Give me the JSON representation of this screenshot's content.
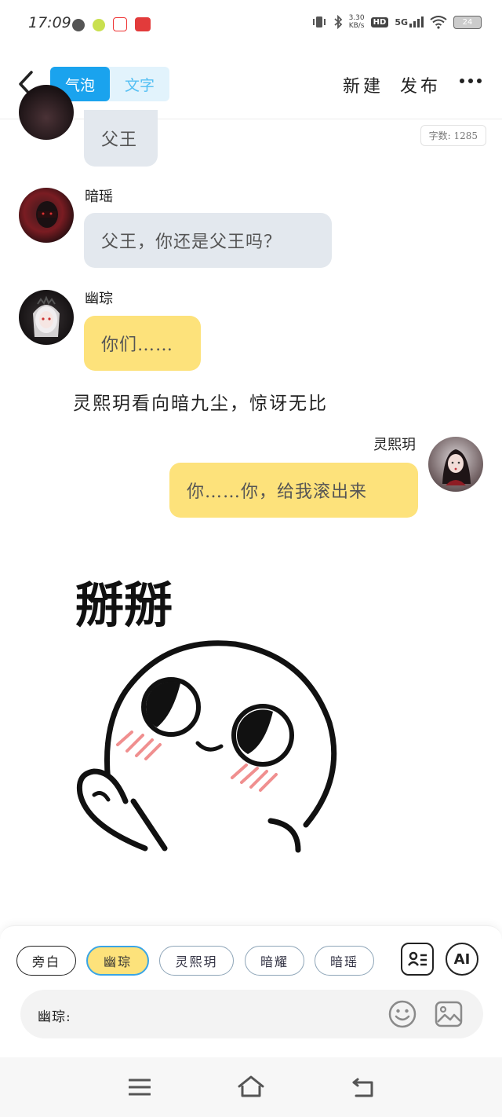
{
  "status_bar": {
    "time": "17:09",
    "net_speed_value": "3.30",
    "net_speed_unit": "KB/s",
    "hd": "HD",
    "network": "5G",
    "battery": "24"
  },
  "top_bar": {
    "tab_bubble": "气泡",
    "tab_text": "文字",
    "new_label": "新建",
    "publish_label": "发布"
  },
  "word_count": "字数: 1285",
  "messages": [
    {
      "text": "父王"
    },
    {
      "name": "暗瑶",
      "text": "父王，你还是父王吗？"
    },
    {
      "name": "幽琮",
      "text": "你们……"
    },
    {
      "narration": "灵熙玥看向暗九尘，惊讶无比"
    },
    {
      "name": "灵熙玥",
      "text": "你……你，给我滚出来"
    }
  ],
  "sticker": {
    "caption": "掰掰"
  },
  "role_chips": [
    "旁白",
    "幽琮",
    "灵熙玥",
    "暗耀",
    "暗瑶"
  ],
  "tools": {
    "ai_label": "AI"
  },
  "input": {
    "speaker_prefix": "幽琮:"
  },
  "colors": {
    "accent": "#1aa3ee",
    "bubble_yellow": "#fde27b",
    "bubble_grey": "#e3e8ee"
  }
}
